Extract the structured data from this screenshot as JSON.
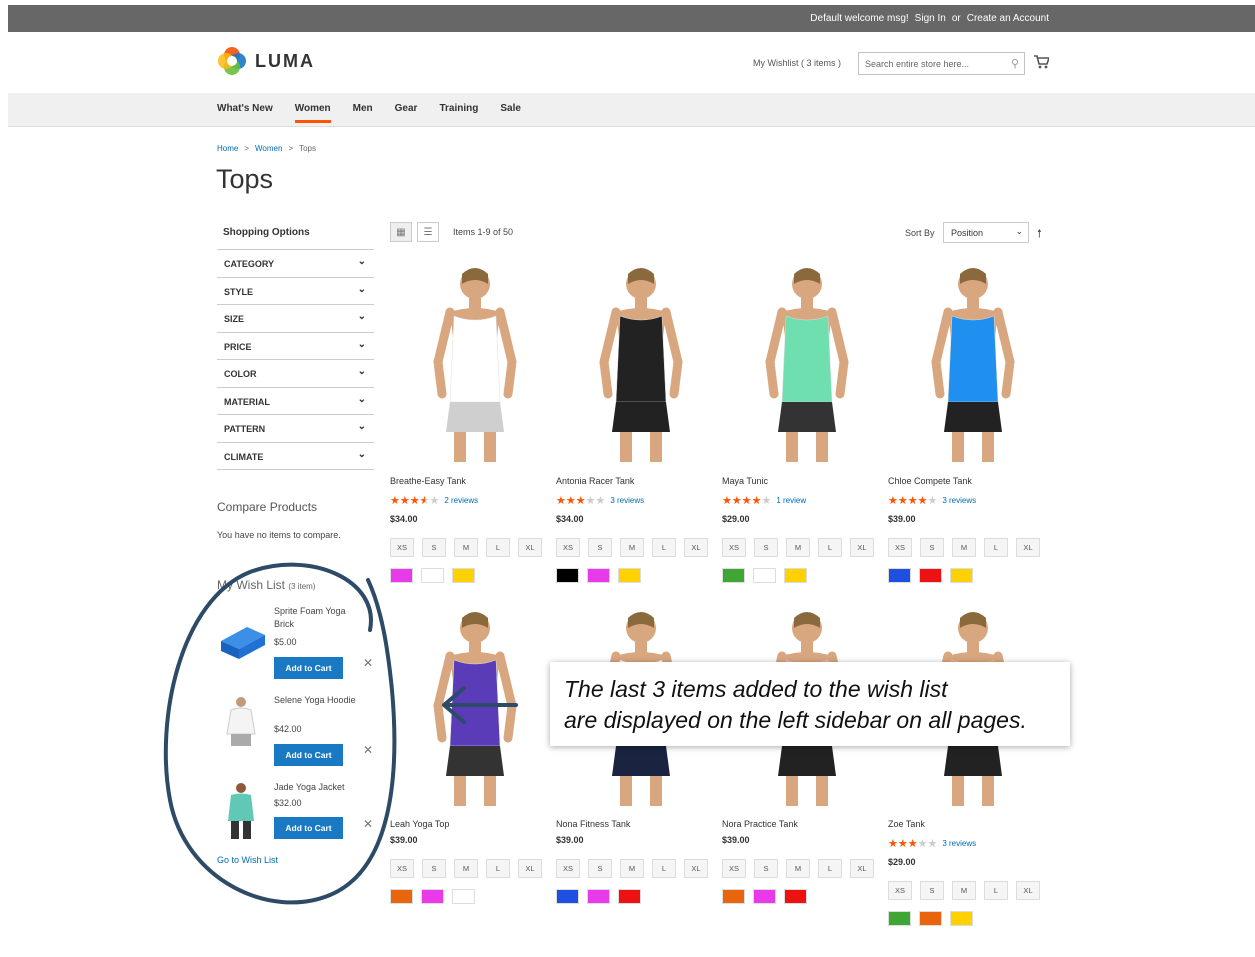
{
  "topbar": {
    "welcome": "Default welcome msg!",
    "sign_in": "Sign In",
    "or": "or",
    "create": "Create an Account"
  },
  "header": {
    "logo": "LUMA",
    "wishlist_link": "My Wishlist ( 3 items )",
    "search_placeholder": "Search entire store here..."
  },
  "nav": {
    "items": [
      "What's New",
      "Women",
      "Men",
      "Gear",
      "Training",
      "Sale"
    ],
    "active": "Women"
  },
  "breadcrumb": {
    "home": "Home",
    "women": "Women",
    "current": "Tops"
  },
  "page_title": "Tops",
  "sidebar": {
    "shopping_options": "Shopping Options",
    "filters": [
      "CATEGORY",
      "STYLE",
      "SIZE",
      "PRICE",
      "COLOR",
      "MATERIAL",
      "PATTERN",
      "CLIMATE"
    ],
    "compare_title": "Compare Products",
    "compare_text": "You have no items to compare.",
    "wishlist_title": "My Wish List",
    "wishlist_count": "(3 item)",
    "wishlist_items": [
      {
        "name": "Sprite Foam Yoga Brick",
        "price": "$5.00",
        "button": "Add to Cart"
      },
      {
        "name": "Selene Yoga Hoodie",
        "price": "$42.00",
        "button": "Add to Cart"
      },
      {
        "name": "Jade Yoga Jacket",
        "price": "$32.00",
        "button": "Add to Cart"
      }
    ],
    "goto_wishlist": "Go to Wish List"
  },
  "toolbar": {
    "items_count": "Items 1-9 of 50",
    "sort_by": "Sort By",
    "sort_value": "Position"
  },
  "products": [
    {
      "name": "Breathe-Easy Tank",
      "rating": 0.7,
      "reviews": "2 reviews",
      "price": "$34.00",
      "top_color": "#ffffff",
      "bottom_color": "#cfcfcf",
      "swatches": [
        "#e83ae8",
        "#ffffff",
        "#ffd100"
      ]
    },
    {
      "name": "Antonia Racer Tank",
      "rating": 0.6,
      "reviews": "3 reviews",
      "price": "$34.00",
      "top_color": "#222222",
      "bottom_color": "#222222",
      "swatches": [
        "#000000",
        "#e83ae8",
        "#ffd100"
      ]
    },
    {
      "name": "Maya Tunic",
      "rating": 0.8,
      "reviews": "1 review",
      "price": "$29.00",
      "top_color": "#6fdfb0",
      "bottom_color": "#333333",
      "swatches": [
        "#3fa535",
        "#ffffff",
        "#ffd100"
      ]
    },
    {
      "name": "Chloe Compete Tank",
      "rating": 0.8,
      "reviews": "3 reviews",
      "price": "$39.00",
      "top_color": "#1f8ff0",
      "bottom_color": "#222222",
      "swatches": [
        "#1f4fe0",
        "#ee1111",
        "#ffd100"
      ]
    },
    {
      "name": "Leah Yoga Top",
      "rating": null,
      "reviews": "",
      "price": "$39.00",
      "top_color": "#5a3cb8",
      "bottom_color": "#333333",
      "swatches": [
        "#e8650d",
        "#e83ae8",
        "#ffffff"
      ]
    },
    {
      "name": "Nona Fitness Tank",
      "rating": null,
      "reviews": "",
      "price": "$39.00",
      "top_color": "#ffffff",
      "bottom_color": "#1a2440",
      "swatches": [
        "#1f4fe0",
        "#e83ae8",
        "#ee1111"
      ]
    },
    {
      "name": "Nora Practice Tank",
      "rating": null,
      "reviews": "",
      "price": "$39.00",
      "top_color": "#f5a3c0",
      "bottom_color": "#222222",
      "swatches": [
        "#e8650d",
        "#e83ae8",
        "#ee1111"
      ]
    },
    {
      "name": "Zoe Tank",
      "rating": 0.6,
      "reviews": "3 reviews",
      "price": "$29.00",
      "top_color": "#f4a540",
      "bottom_color": "#222222",
      "swatches": [
        "#3fa535",
        "#e8650d",
        "#ffd100"
      ]
    }
  ],
  "sizes": [
    "XS",
    "S",
    "M",
    "L",
    "XL"
  ],
  "callout": {
    "line1": "The last 3 items added to the wish list",
    "line2": "are displayed on the left sidebar on all pages."
  },
  "colors": {
    "accent": "#ff5501",
    "link": "#006bb4",
    "button": "#1979c3",
    "topbar": "#676767",
    "annotation": "#2d4a66"
  }
}
